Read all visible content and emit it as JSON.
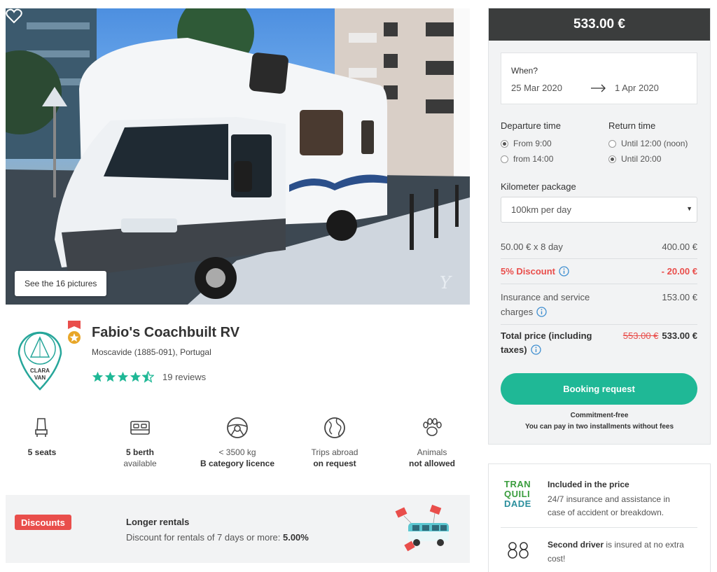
{
  "gallery": {
    "pictures_button": "See the 16 pictures",
    "watermark": "Y"
  },
  "vehicle": {
    "owner_logo_line1": "CLARA",
    "owner_logo_line2": "VAN",
    "title": "Fabio's Coachbuilt RV",
    "location": "Moscavide (1885-091), Portugal",
    "rating": 4.5,
    "reviews": "19 reviews"
  },
  "features": [
    {
      "icon": "seat-icon",
      "line1": "5 seats",
      "line2": ""
    },
    {
      "icon": "bed-icon",
      "line1": "5 berth",
      "line2": "available"
    },
    {
      "icon": "steering-wheel-icon",
      "line1": "< 3500 kg",
      "line2": "B category licence"
    },
    {
      "icon": "globe-icon",
      "line1": "Trips abroad",
      "line2": "on request"
    },
    {
      "icon": "paw-icon",
      "line1": "Animals",
      "line2": "not allowed"
    }
  ],
  "discounts": {
    "tag": "Discounts",
    "title": "Longer rentals",
    "text": "Discount for rentals of 7 days or more: ",
    "value": "5.00%"
  },
  "booking": {
    "header_price": "533.00 €",
    "when_label": "When?",
    "date_start": "25 Mar 2020",
    "date_end": "1 Apr 2020",
    "departure_title": "Departure time",
    "departure_options": [
      "From 9:00",
      "from 14:00"
    ],
    "departure_selected": 0,
    "return_title": "Return time",
    "return_options": [
      "Until 12:00 (noon)",
      "Until 20:00"
    ],
    "return_selected": 1,
    "km_label": "Kilometer package",
    "km_value": "100km per day",
    "lines": {
      "base_label": "50.00 € x 8 day",
      "base_value": "400.00 €",
      "discount_label": "5% Discount",
      "discount_value": "- 20.00 €",
      "insurance_label_1": "Insurance and service",
      "insurance_label_2": "charges",
      "insurance_value": "153.00 €",
      "total_label_1": "Total price (including",
      "total_label_2": "taxes)",
      "total_old": "553.00 €",
      "total_new": "533.00 €"
    },
    "button": "Booking request",
    "commitment": "Commitment-free",
    "installments": "You can pay in two installments without fees"
  },
  "included": {
    "logo_lines": [
      "TRAN",
      "QUILI",
      "DADE"
    ],
    "title": "Included in the price",
    "text": "24/7 insurance and assistance in case of accident or breakdown.",
    "driver_bold": "Second driver",
    "driver_text": " is insured at no extra cost!"
  },
  "colors": {
    "accent": "#1fb896",
    "discount_red": "#e94e4b",
    "header_dark": "#3b3d3d",
    "star": "#1fb896",
    "badge": "#e8a628"
  }
}
